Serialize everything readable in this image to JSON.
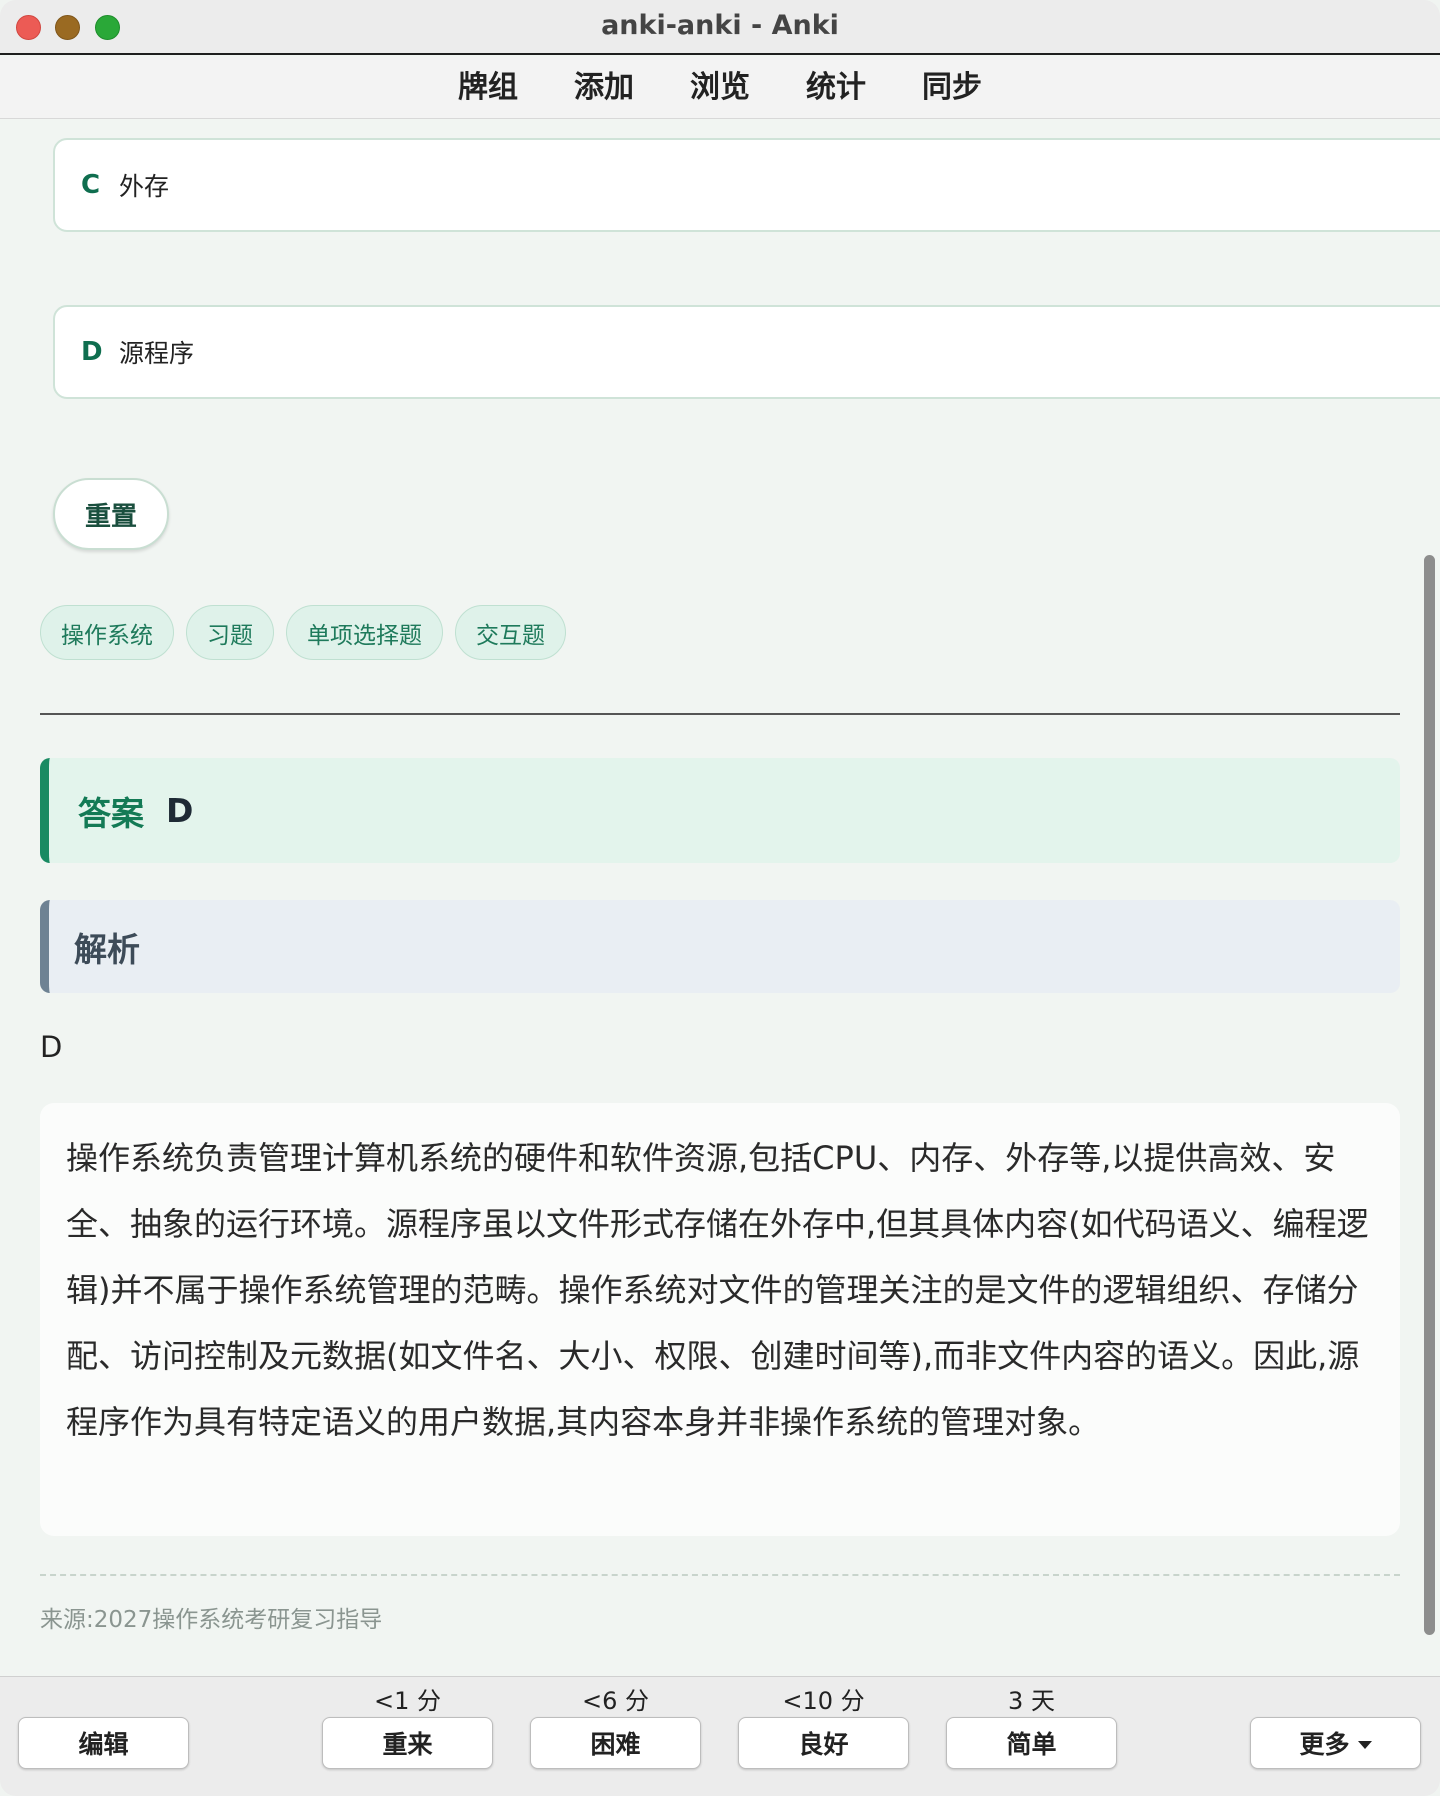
{
  "window": {
    "title": "anki-anki - Anki"
  },
  "menu": {
    "items": [
      "牌组",
      "添加",
      "浏览",
      "统计",
      "同步"
    ]
  },
  "options": [
    {
      "letter": "C",
      "text": "外存"
    },
    {
      "letter": "D",
      "text": "源程序"
    }
  ],
  "reset_label": "重置",
  "tags": [
    "操作系统",
    "习题",
    "单项选择题",
    "交互题"
  ],
  "answer": {
    "label": "答案",
    "value": "D"
  },
  "analysis": {
    "label": "解析",
    "answer_plain": "D",
    "text": "操作系统负责管理计算机系统的硬件和软件资源,包括CPU、内存、外存等,以提供高效、安全、抽象的运行环境。源程序虽以文件形式存储在外存中,但其具体内容(如代码语义、编程逻辑)并不属于操作系统管理的范畴。操作系统对文件的管理关注的是文件的逻辑组织、存储分配、访问控制及元数据(如文件名、大小、权限、创建时间等),而非文件内容的语义。因此,源程序作为具有特定语义的用户数据,其内容本身并非操作系统的管理对象。"
  },
  "source": {
    "label": "来源:",
    "value": "2027操作系统考研复习指导"
  },
  "bottom": {
    "edit": "编辑",
    "again": {
      "interval": "<1 分",
      "label": "重来"
    },
    "hard": {
      "interval": "<6 分",
      "label": "困难"
    },
    "good": {
      "interval": "<10 分",
      "label": "良好"
    },
    "easy": {
      "interval": "3 天",
      "label": "简单"
    },
    "more": "更多"
  }
}
